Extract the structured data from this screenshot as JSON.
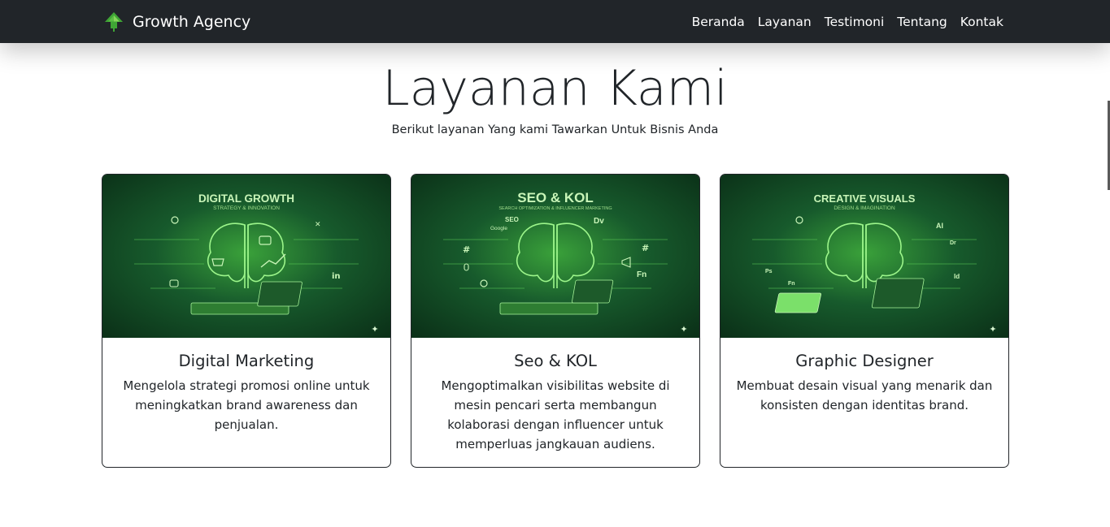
{
  "brand": {
    "name": "Growth Agency",
    "logo_icon": "leaf-arrow-icon"
  },
  "nav": {
    "items": [
      "Beranda",
      "Layanan",
      "Testimoni",
      "Tentang",
      "Kontak"
    ]
  },
  "section": {
    "title": "Layanan Kami",
    "subtitle": "Berikut layanan Yang kami Tawarkan Untuk Bisnis Anda"
  },
  "cards": [
    {
      "title": "Digital Marketing",
      "description": "Mengelola strategi promosi online untuk meningkatkan brand awareness dan penjualan.",
      "image": {
        "heading": "DIGITAL GROWTH",
        "tagline": "STRATEGY & INNOVATION",
        "icons": [
          "search-icon",
          "cart-icon",
          "play-icon",
          "chart-icon",
          "x-icon",
          "linkedin-icon",
          "instagram-icon"
        ]
      }
    },
    {
      "title": "Seo & KOL",
      "description": "Mengoptimalkan visibilitas website di mesin pencari serta membangun kolaborasi dengan influencer untuk memperluas jangkauan audiens.",
      "image": {
        "heading": "SEO & KOL",
        "tagline": "SEARCH OPTIMIZATION & INFLUENCER MARKETING",
        "icons": [
          "seo-icon",
          "google-icon",
          "hashtag-icon",
          "microphone-icon",
          "megaphone-icon",
          "search-icon"
        ]
      }
    },
    {
      "title": "Graphic Designer",
      "description": "Membuat desain visual yang menarik dan konsisten dengan identitas brand.",
      "image": {
        "heading": "CREATIVE VISUALS",
        "tagline": "DESIGN & IMAGINATION",
        "icons": [
          "ai-icon",
          "dreamweaver-icon",
          "photoshop-icon",
          "indesign-icon",
          "fonts-icon"
        ]
      }
    }
  ],
  "colors": {
    "navbar": "#212529",
    "accent_green": "#4caf50",
    "image_glow": "#8ef07a",
    "text": "#212529"
  }
}
